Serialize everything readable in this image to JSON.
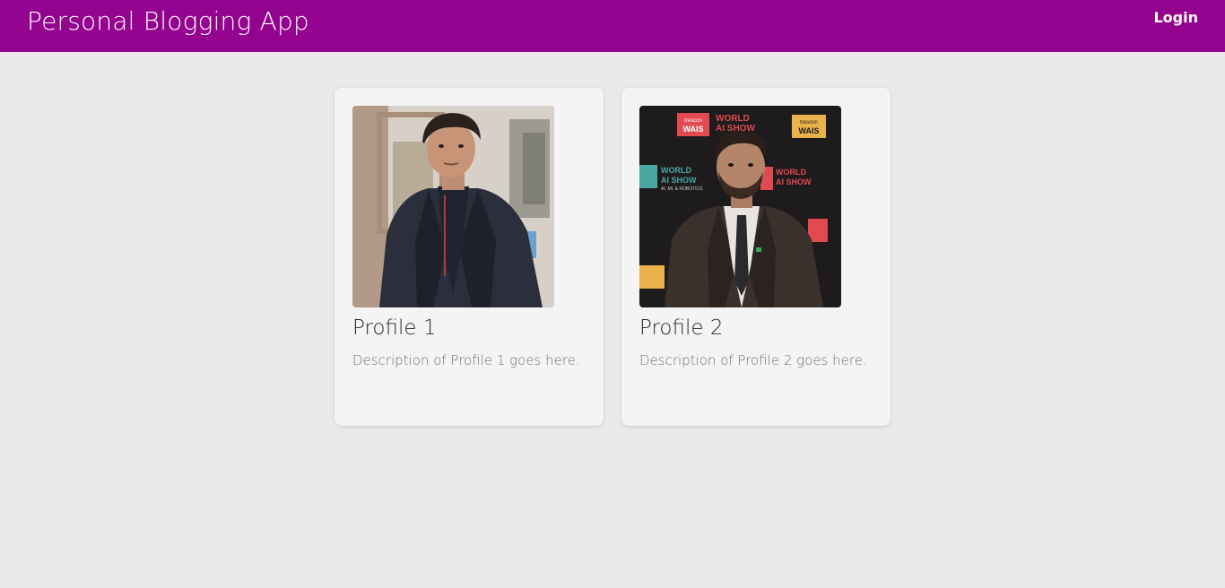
{
  "header": {
    "title": "Personal Blogging App",
    "login_label": "Login",
    "background_color": "#94038f"
  },
  "profiles": [
    {
      "title": "Profile 1",
      "description": "Description of Profile 1 goes here."
    },
    {
      "title": "Profile 2",
      "description": "Description of Profile 2 goes here."
    }
  ],
  "backdrop_sign": {
    "brand": "trescon",
    "event": "WAIS",
    "show_line1": "WORLD",
    "show_line2": "AI SHOW",
    "show_tagline": "AI, ML & ROBOTICS"
  },
  "colors": {
    "page_background": "#ebe9ea",
    "card_background": "#f4f4f4",
    "title_text": "#2b2b2b",
    "description_text": "#707070"
  }
}
